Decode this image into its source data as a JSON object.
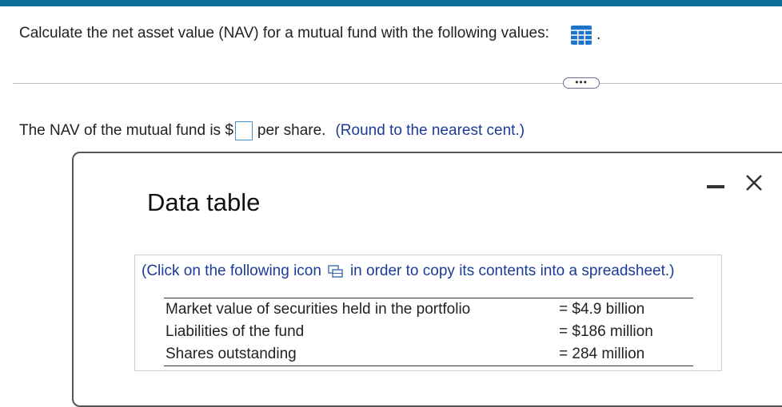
{
  "question": {
    "text": "Calculate the net asset value (NAV) for a mutual fund with the following values:",
    "trailing": ".",
    "table_icon": "grid-table-icon"
  },
  "divider": {
    "more_label": "•••"
  },
  "answer": {
    "prefix": "The NAV of the mutual fund is $",
    "input_value": "",
    "suffix": "per share.",
    "hint": "(Round to the nearest cent.)"
  },
  "dialog": {
    "title": "Data table",
    "minimize_icon": "minimize-icon",
    "close_icon": "close-icon",
    "copy_prefix": "(Click on the following icon",
    "copy_suffix": "in order to copy its contents into a spreadsheet.)",
    "rows": [
      {
        "label": "Market value of securities held in the portfolio",
        "value": "= $4.9 billion"
      },
      {
        "label": "Liabilities of the fund",
        "value": "= $186 million"
      },
      {
        "label": "Shares outstanding",
        "value": "= 284 million"
      }
    ]
  },
  "colors": {
    "topbar": "#0b6f96",
    "hint": "#1a3c96",
    "icon": "#1d74c9"
  }
}
